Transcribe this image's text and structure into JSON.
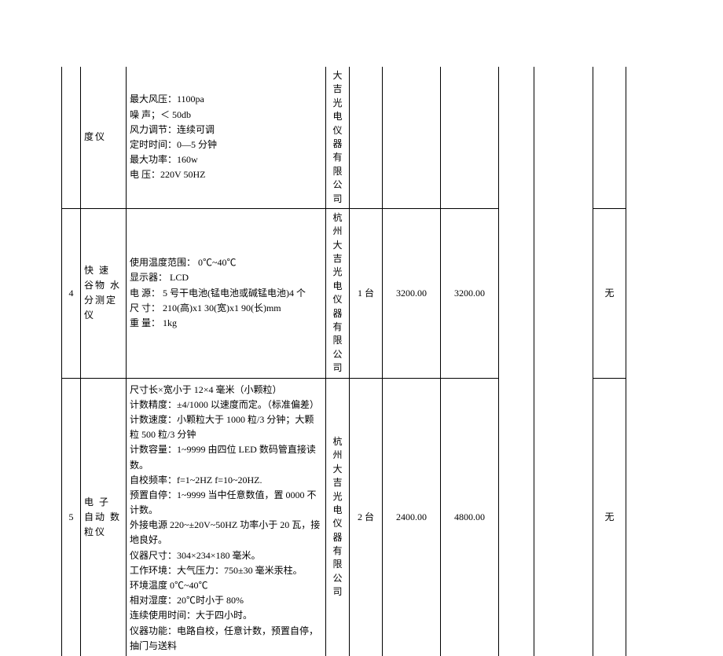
{
  "rows": [
    {
      "idx": "",
      "name": "度仪",
      "spec": [
        "最大风压：1100pa",
        "噪 声；＜ 50db",
        "风力调节：连续可调",
        "定时时间：0—5 分钟",
        "最大功率：160w",
        "电 压：220V 50HZ"
      ],
      "mfr": "大吉光电仪器有限公司",
      "qty": "",
      "price": "",
      "total": "",
      "c8": "",
      "c9": "",
      "c10": ""
    },
    {
      "idx": "4",
      "name": "快 速 谷物 水 分测定仪",
      "spec": [
        "使用温度范围： 0℃~40℃",
        "显示器：  LCD",
        "电  源：  5 号干电池(锰电池或碱锰电池)4 个",
        "尺  寸：  210(高)x1 30(宽)x1 90(长)mm",
        "重  量：  1kg"
      ],
      "mfr": "杭州大吉光电仪器有限公司",
      "qty": "1 台",
      "price": "3200.00",
      "total": "3200.00",
      "c8": "",
      "c9": "",
      "c10": "无"
    },
    {
      "idx": "5",
      "name": "电 子 自动 数 粒仪",
      "spec": [
        "尺寸长×宽小于 12×4 毫米（小颗粒）",
        "计数精度：±4/1000 以速度而定。（标准偏差）",
        "计数速度：小颗粒大于 1000 粒/3 分钟；大颗粒 500 粒/3 分钟",
        "计数容量：1~9999 由四位 LED 数码管直接读数。",
        "自校频率：f=1~2HZ f=10~20HZ.",
        "预置自停：1~9999 当中任意数值，置 0000 不计数。",
        "外接电源 220~±20V~50HZ 功率小于 20 瓦，接地良好。",
        "仪器尺寸：304×234×180 毫米。",
        "工作环境：大气压力：750±30 毫米汞柱。",
        "环境温度 0℃~40℃",
        "相对湿度：20℃时小于 80%",
        "连续使用时间：大于四小时。",
        "仪器功能：电路自校，任意计数，预置自停，抽门与送料"
      ],
      "mfr": "杭州大吉光电仪器有限公司",
      "qty": "2 台",
      "price": "2400.00",
      "total": "4800.00",
      "c8": "",
      "c9": "",
      "c10": "无"
    }
  ]
}
